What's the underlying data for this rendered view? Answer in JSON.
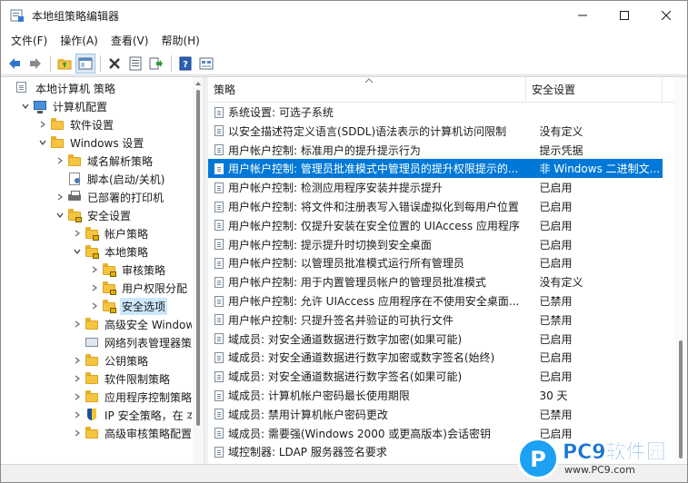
{
  "window": {
    "title": "本地组策略编辑器",
    "colors": {
      "accent": "#0078d7",
      "selection_tree": "#cce8ff"
    }
  },
  "menu": [
    "文件(F)",
    "操作(A)",
    "查看(V)",
    "帮助(H)"
  ],
  "toolbar_icons": [
    "back-icon",
    "forward-icon",
    "up-folder-icon",
    "show-tree-icon",
    "delete-icon",
    "properties-icon",
    "export-icon",
    "help-icon",
    "view-icon"
  ],
  "tree": [
    {
      "label": "本地计算机 策略",
      "indent": 0,
      "expander": "",
      "icon": "doc"
    },
    {
      "label": "计算机配置",
      "indent": 1,
      "expander": "down",
      "icon": "pc"
    },
    {
      "label": "软件设置",
      "indent": 2,
      "expander": "right",
      "icon": "folder"
    },
    {
      "label": "Windows 设置",
      "indent": 2,
      "expander": "down",
      "icon": "folder"
    },
    {
      "label": "域名解析策略",
      "indent": 3,
      "expander": "right",
      "icon": "folder"
    },
    {
      "label": "脚本(启动/关机)",
      "indent": 3,
      "expander": "",
      "icon": "script"
    },
    {
      "label": "已部署的打印机",
      "indent": 3,
      "expander": "right",
      "icon": "printer"
    },
    {
      "label": "安全设置",
      "indent": 3,
      "expander": "down",
      "icon": "folder-lock"
    },
    {
      "label": "帐户策略",
      "indent": 4,
      "expander": "right",
      "icon": "folder-lock"
    },
    {
      "label": "本地策略",
      "indent": 4,
      "expander": "down",
      "icon": "folder-lock"
    },
    {
      "label": "审核策略",
      "indent": 5,
      "expander": "right",
      "icon": "folder-lock"
    },
    {
      "label": "用户权限分配",
      "indent": 5,
      "expander": "right",
      "icon": "folder-lock"
    },
    {
      "label": "安全选项",
      "indent": 5,
      "expander": "right",
      "icon": "folder-lock",
      "selected": true
    },
    {
      "label": "高级安全 Window",
      "indent": 4,
      "expander": "right",
      "icon": "folder"
    },
    {
      "label": "网络列表管理器策略",
      "indent": 4,
      "expander": "",
      "icon": "netlist"
    },
    {
      "label": "公钥策略",
      "indent": 4,
      "expander": "right",
      "icon": "folder"
    },
    {
      "label": "软件限制策略",
      "indent": 4,
      "expander": "right",
      "icon": "folder"
    },
    {
      "label": "应用程序控制策略",
      "indent": 4,
      "expander": "right",
      "icon": "folder"
    },
    {
      "label": "IP 安全策略，在 本",
      "indent": 4,
      "expander": "right",
      "icon": "shield"
    },
    {
      "label": "高级审核策略配置",
      "indent": 4,
      "expander": "right",
      "icon": "folder"
    }
  ],
  "list": {
    "columns": {
      "policy": "策略",
      "setting": "安全设置"
    },
    "rows": [
      {
        "policy": "系统设置: 可选子系统",
        "setting": ""
      },
      {
        "policy": "以安全描述符定义语言(SDDL)语法表示的计算机访问限制",
        "setting": "没有定义"
      },
      {
        "policy": "用户帐户控制: 标准用户的提升提示行为",
        "setting": "提示凭据"
      },
      {
        "policy": "用户帐户控制: 管理员批准模式中管理员的提升权限提示的...",
        "setting": "非 Windows 二进制文...",
        "selected": true
      },
      {
        "policy": "用户帐户控制: 检测应用程序安装并提示提升",
        "setting": "已启用"
      },
      {
        "policy": "用户帐户控制: 将文件和注册表写入错误虚拟化到每用户位置",
        "setting": "已启用"
      },
      {
        "policy": "用户帐户控制: 仅提升安装在安全位置的 UIAccess 应用程序",
        "setting": "已启用"
      },
      {
        "policy": "用户帐户控制: 提示提升时切换到安全桌面",
        "setting": "已启用"
      },
      {
        "policy": "用户帐户控制: 以管理员批准模式运行所有管理员",
        "setting": "已启用"
      },
      {
        "policy": "用户帐户控制: 用于内置管理员帐户的管理员批准模式",
        "setting": "没有定义"
      },
      {
        "policy": "用户帐户控制: 允许 UIAccess 应用程序在不使用安全桌面...",
        "setting": "已禁用"
      },
      {
        "policy": "用户帐户控制: 只提升签名并验证的可执行文件",
        "setting": "已禁用"
      },
      {
        "policy": "域成员: 对安全通道数据进行数字加密(如果可能)",
        "setting": "已启用"
      },
      {
        "policy": "域成员: 对安全通道数据进行数字加密或数字签名(始终)",
        "setting": "已启用"
      },
      {
        "policy": "域成员: 对安全通道数据进行数字签名(如果可能)",
        "setting": "已启用"
      },
      {
        "policy": "域成员: 计算机帐户密码最长使用期限",
        "setting": "30 天"
      },
      {
        "policy": "域成员: 禁用计算机帐户密码更改",
        "setting": "已禁用"
      },
      {
        "policy": "域成员: 需要强(Windows 2000 或更高版本)会话密钥",
        "setting": "已启用"
      },
      {
        "policy": "域控制器: LDAP 服务器签名要求",
        "setting": ""
      }
    ]
  },
  "watermark": {
    "brand": "PC9软件园",
    "url": "www.PC9.com"
  }
}
